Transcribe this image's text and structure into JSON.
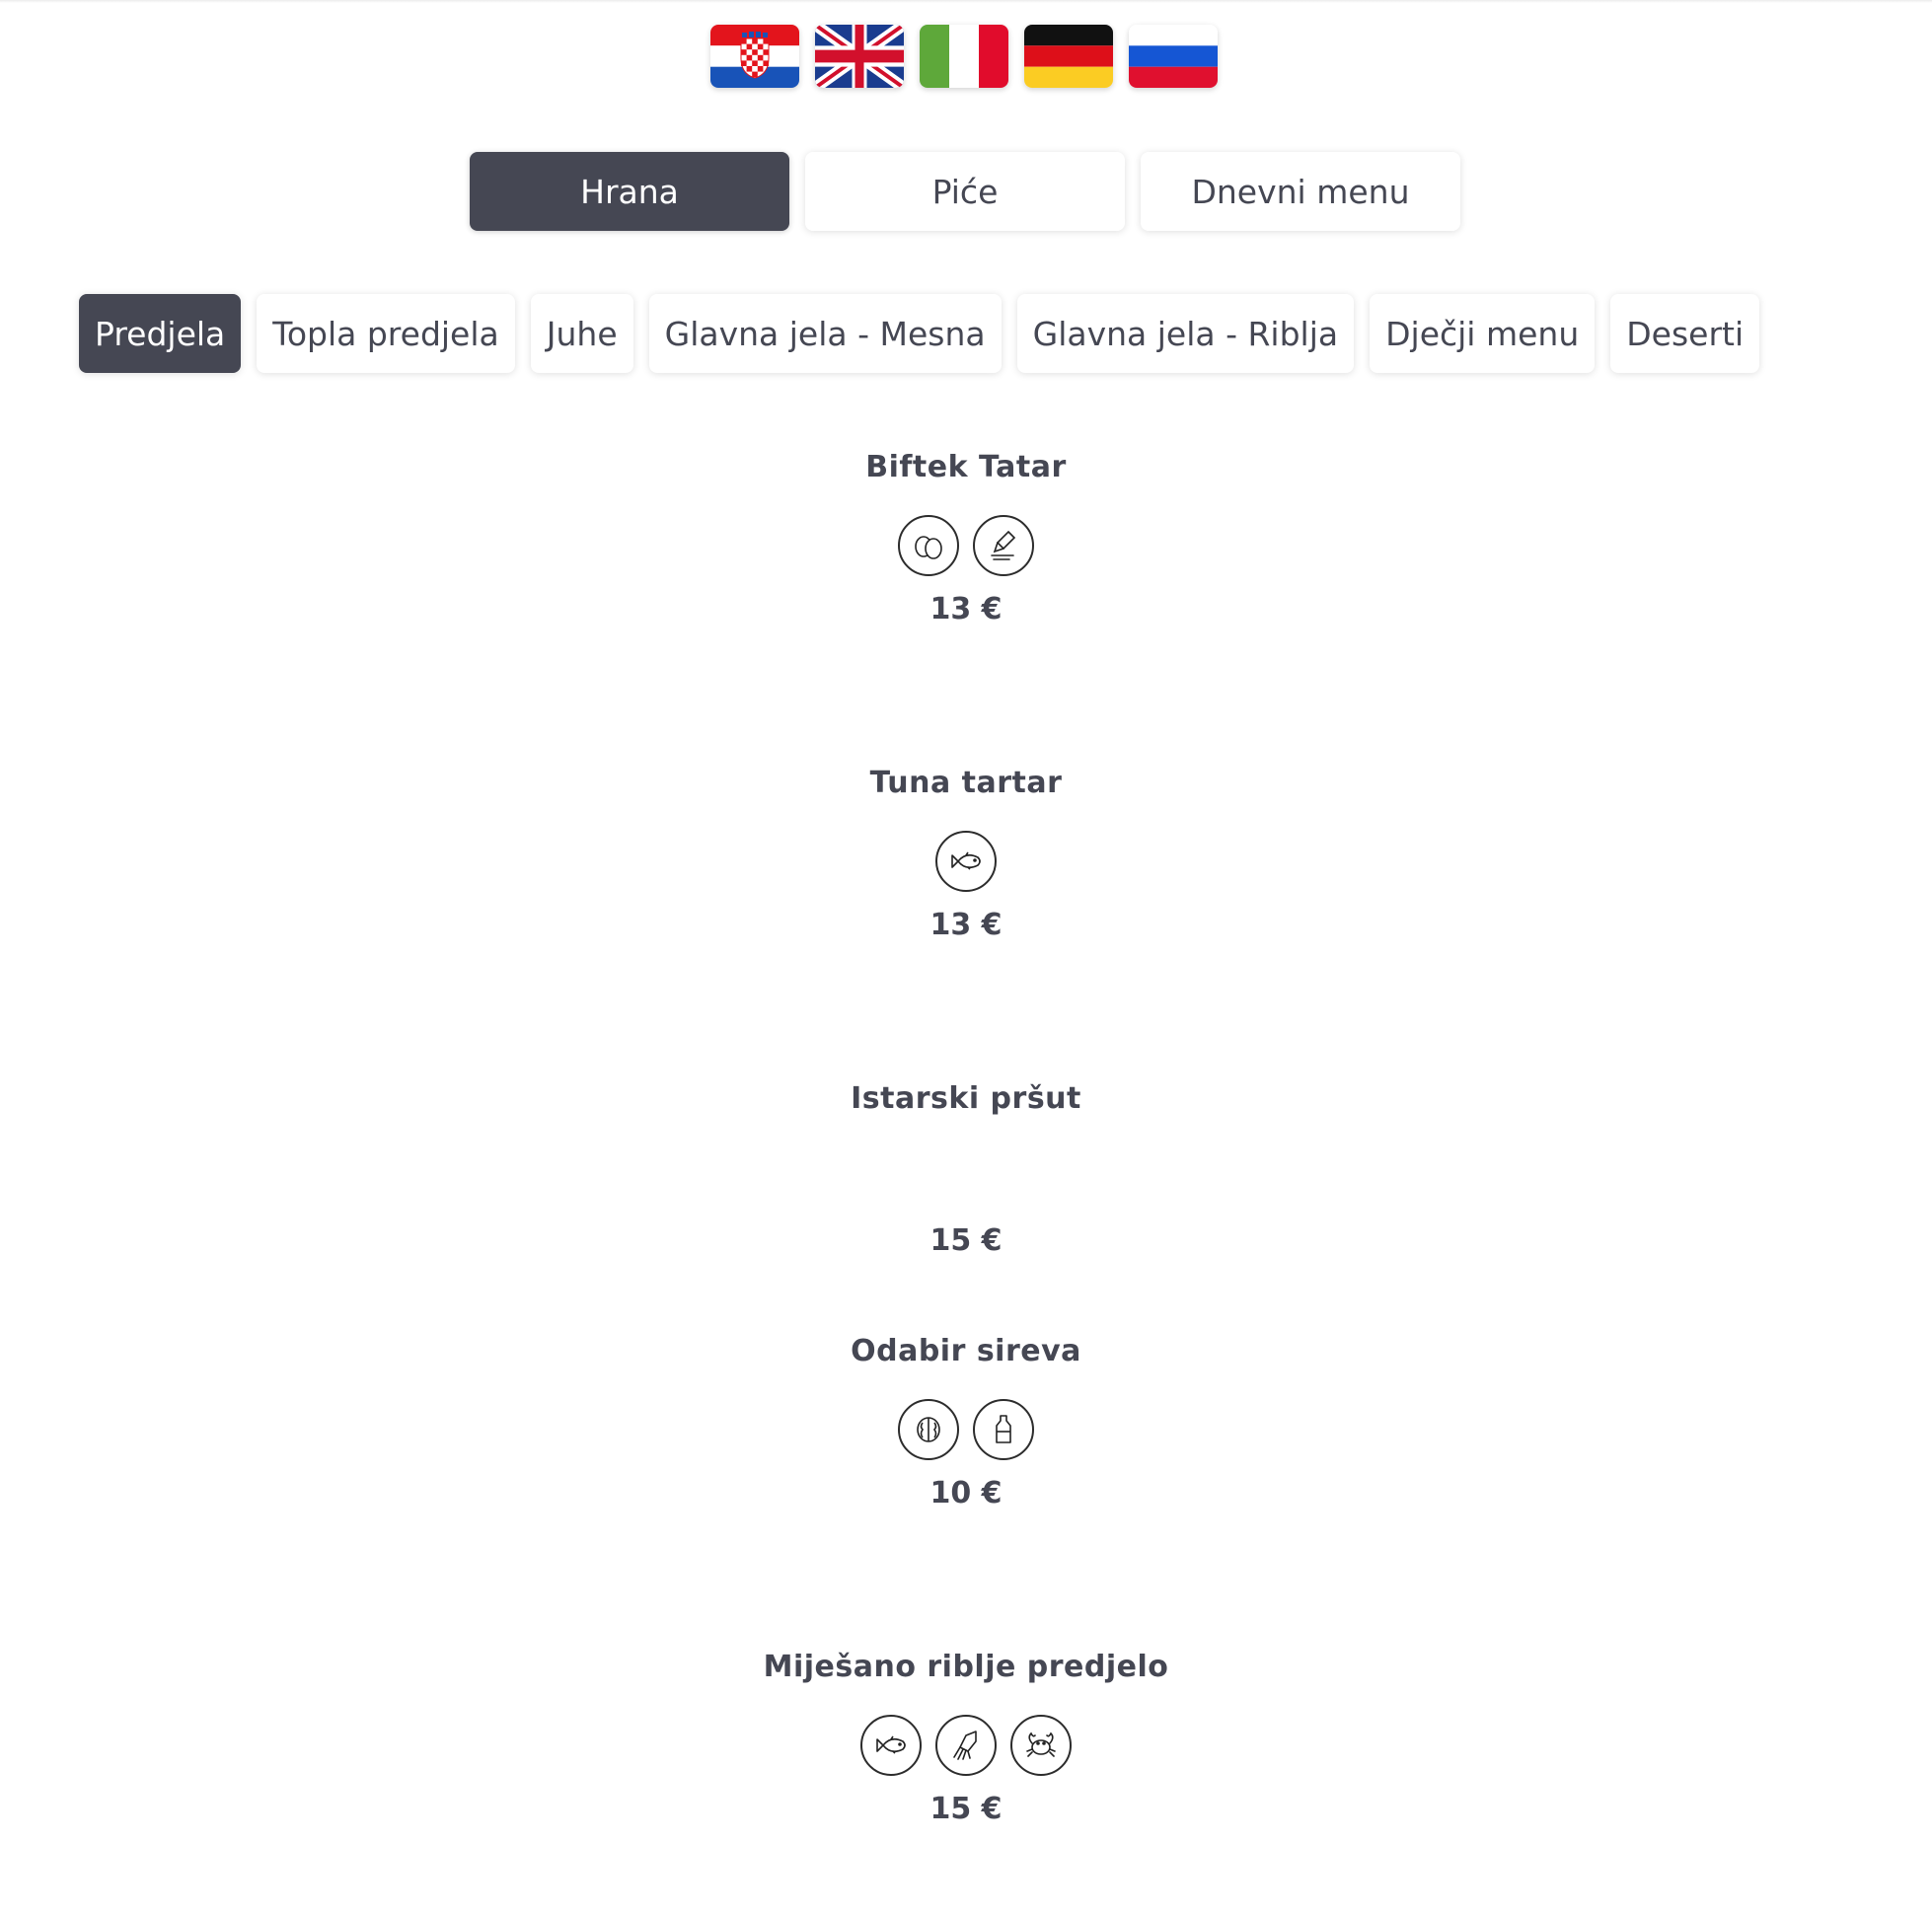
{
  "languages": [
    {
      "code": "hr",
      "name": "Hrvatski"
    },
    {
      "code": "en",
      "name": "English"
    },
    {
      "code": "it",
      "name": "Italiano"
    },
    {
      "code": "de",
      "name": "Deutsch"
    },
    {
      "code": "ru",
      "name": "Русский"
    }
  ],
  "main_tabs": [
    {
      "label": "Hrana",
      "active": true
    },
    {
      "label": "Piće",
      "active": false
    },
    {
      "label": "Dnevni menu",
      "active": false
    }
  ],
  "categories": [
    {
      "label": "Predjela",
      "active": true
    },
    {
      "label": "Topla predjela",
      "active": false
    },
    {
      "label": "Juhe",
      "active": false
    },
    {
      "label": "Glavna jela - Mesna",
      "active": false
    },
    {
      "label": "Glavna jela - Riblja",
      "active": false
    },
    {
      "label": "Dječji menu",
      "active": false
    },
    {
      "label": "Deserti",
      "active": false
    }
  ],
  "items": [
    {
      "name": "Biftek Tatar",
      "allergens": [
        "egg-icon",
        "mustard-icon"
      ],
      "price": "13 €"
    },
    {
      "name": "Tuna tartar",
      "allergens": [
        "fish-icon"
      ],
      "price": "13 €"
    },
    {
      "name": "Istarski pršut",
      "allergens": [],
      "price": "15 €"
    },
    {
      "name": "Odabir sireva",
      "allergens": [
        "nuts-icon",
        "milk-icon"
      ],
      "price": "10 €"
    },
    {
      "name": "Miješano riblje predjelo",
      "allergens": [
        "fish-icon",
        "mollusc-icon",
        "crustacean-icon"
      ],
      "price": "15 €"
    }
  ],
  "colors": {
    "active_bg": "#454753",
    "text": "#454753",
    "background": "#ffffff"
  }
}
